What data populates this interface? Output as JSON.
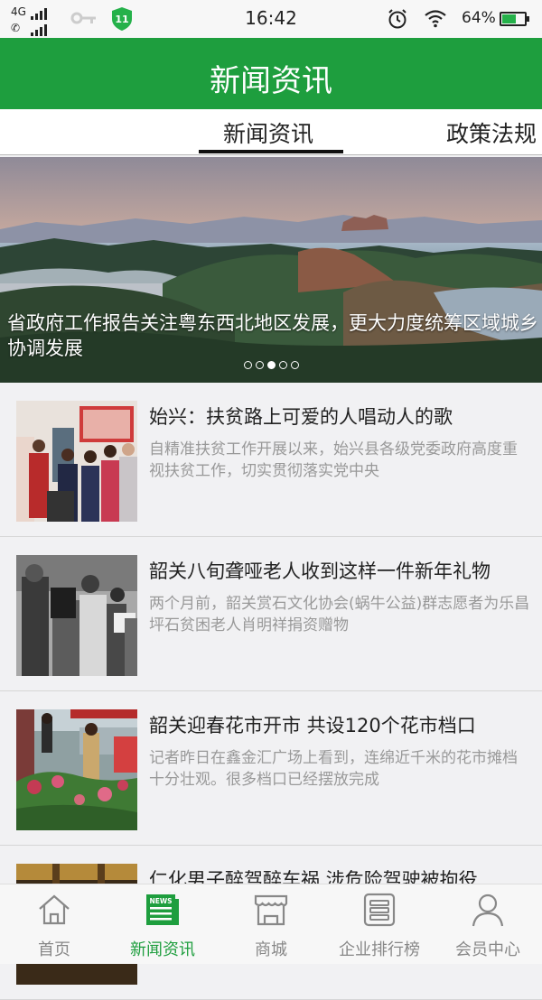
{
  "status_bar": {
    "network_label": "4G",
    "time": "16:42",
    "battery_text": "64%",
    "battery_level": 0.64,
    "icons": [
      "signal-icon",
      "key-icon",
      "shield-icon",
      "alarm-icon",
      "wifi-icon",
      "battery-icon"
    ]
  },
  "header": {
    "title": "新闻资讯"
  },
  "tabs": [
    {
      "label": "新闻资讯",
      "active": true
    },
    {
      "label": "政策法规",
      "active": false
    }
  ],
  "banner": {
    "caption": "省政府工作报告关注粤东西北地区发展，更大力度统筹区域城乡协调发展",
    "slide_count": 5,
    "active_slide_index": 2
  },
  "news": [
    {
      "title": "始兴：扶贫路上可爱的人唱动人的歌",
      "summary": "自精准扶贫工作开展以来，始兴县各级党委政府高度重视扶贫工作，切实贯彻落实党中央"
    },
    {
      "title": "韶关八旬聋哑老人收到这样一件新年礼物",
      "summary": "两个月前，韶关赏石文化协会(蜗牛公益)群志愿者为乐昌坪石贫困老人肖明祥捐资赠物"
    },
    {
      "title": "韶关迎春花市开市 共设120个花市档口",
      "summary": "记者昨日在鑫金汇广场上看到，连绵近千米的花市摊档十分壮观。很多档口已经摆放完成"
    },
    {
      "title": "仁化男子醉驾醉车祸 涉危险驾驶被拘役",
      "summary": ""
    }
  ],
  "bottom_nav": [
    {
      "label": "首页",
      "icon": "home-icon",
      "active": false
    },
    {
      "label": "新闻资讯",
      "icon": "news-icon",
      "active": true,
      "badge": "NEWS"
    },
    {
      "label": "商城",
      "icon": "store-icon",
      "active": false
    },
    {
      "label": "企业排行榜",
      "icon": "ranking-icon",
      "active": false
    },
    {
      "label": "会员中心",
      "icon": "user-icon",
      "active": false
    }
  ],
  "colors": {
    "brand": "#1e9e3e",
    "header_bg": "#1e9e3e",
    "inactive_text": "#888888",
    "summary_text": "#999999"
  }
}
